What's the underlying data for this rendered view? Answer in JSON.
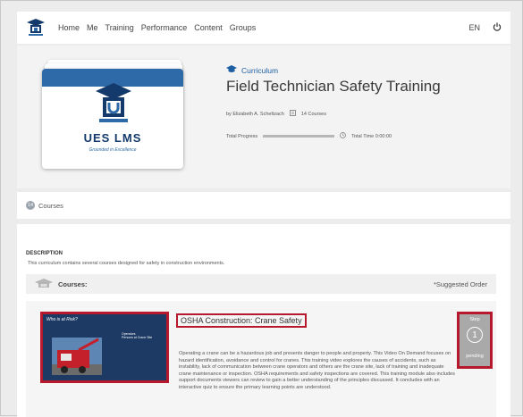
{
  "nav": {
    "items": [
      "Home",
      "Me",
      "Training",
      "Performance",
      "Content",
      "Groups"
    ],
    "language": "EN",
    "colors": {
      "brand": "#143a6b",
      "accent": "#2f6aa8"
    }
  },
  "hero": {
    "card_brand": "UES LMS",
    "card_tagline": "Grounded in Excellence",
    "kind": "Curriculum",
    "title": "Field Technician Safety Training",
    "author": "by Elizabeth A. Scheltzach",
    "course_count": "14 Courses",
    "progress_label": "Total Progress",
    "time_label": "Total Time 0:00:00"
  },
  "strip": {
    "count": "14",
    "label": "Courses"
  },
  "main": {
    "description_label": "DESCRIPTION",
    "description": "This curriculum contains several courses designed for safety in construction environments.",
    "courses_label": "Courses:",
    "suggested": "*Suggested Order",
    "course": {
      "thumb_question": "Who is at Risk?",
      "thumb_operators": "Operators",
      "thumb_persons": "Persons at Crane Site",
      "title": "OSHA Construction: Crane Safety",
      "description": "Operating a crane can be a hazardous job and presents danger to people and property. This Video On Demand focuses on hazard identification, avoidance and control for cranes. This training video explores the causes of accidents, such as instability, lack of communication between crane operators and others are the crane site, lack of training and inadequate crane maintenance or inspection. OSHA requirements and safety inspections are covered. This training module also includes support documents viewers can review to gain a better understanding of the principles discussed. It concludes with an interactive quiz to ensure the primary learning points are understood.",
      "step_label": "Step",
      "step_number": "1",
      "step_status": "pending"
    }
  }
}
